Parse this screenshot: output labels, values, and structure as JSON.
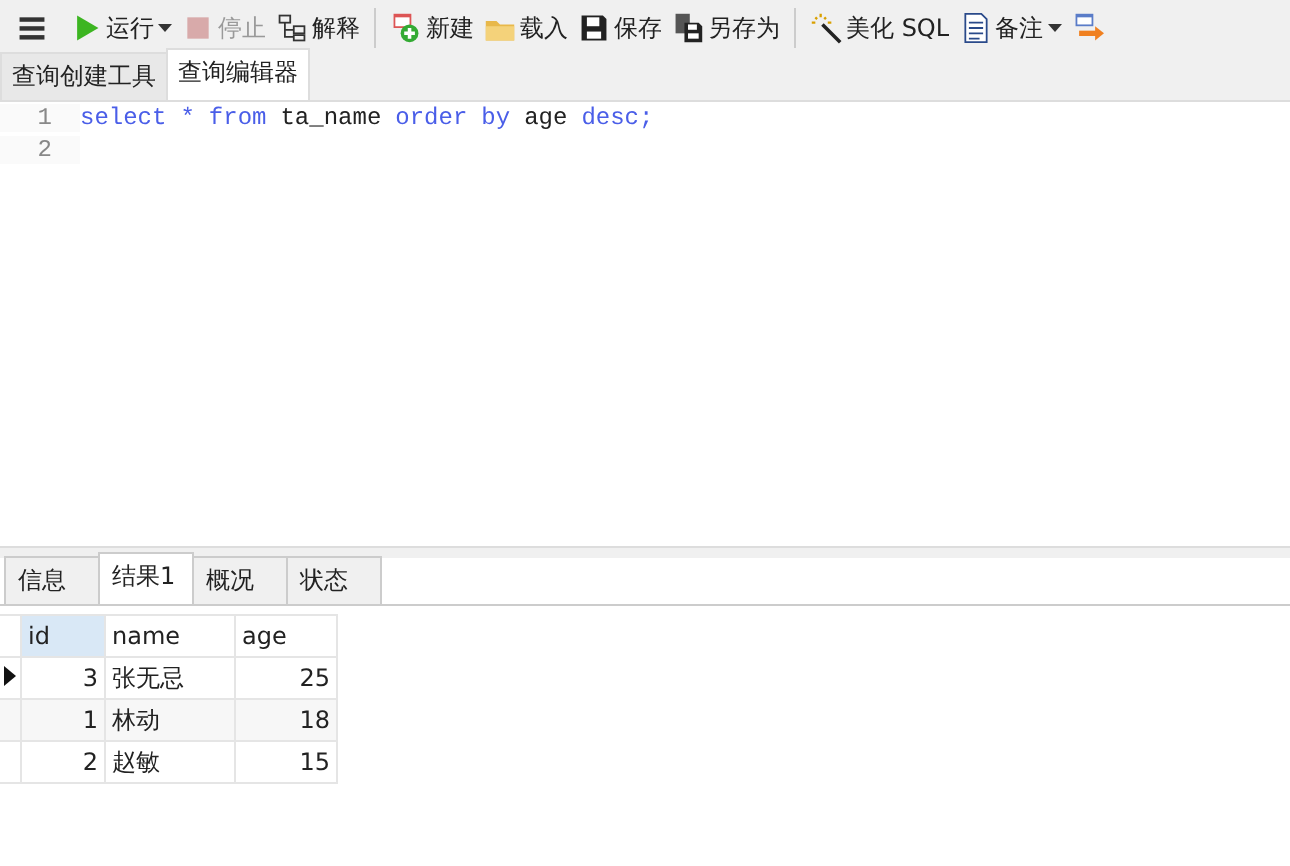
{
  "toolbar": [
    {
      "kind": "menu"
    },
    {
      "kind": "run",
      "label": "运行",
      "dropdown": true,
      "disabled": false
    },
    {
      "kind": "stop",
      "label": "停止",
      "dropdown": false,
      "disabled": true
    },
    {
      "kind": "explain",
      "label": "解释",
      "dropdown": false,
      "disabled": false
    },
    {
      "kind": "separator"
    },
    {
      "kind": "new",
      "label": "新建",
      "dropdown": false,
      "disabled": false
    },
    {
      "kind": "load",
      "label": "载入",
      "dropdown": false,
      "disabled": false
    },
    {
      "kind": "save",
      "label": "保存",
      "dropdown": false,
      "disabled": false
    },
    {
      "kind": "saveas",
      "label": "另存为",
      "dropdown": false,
      "disabled": false
    },
    {
      "kind": "separator"
    },
    {
      "kind": "beautify",
      "label": "美化 SQL",
      "dropdown": false,
      "disabled": false
    },
    {
      "kind": "note",
      "label": "备注",
      "dropdown": true,
      "disabled": false
    },
    {
      "kind": "export"
    }
  ],
  "editor_tabs": [
    {
      "label": "查询创建工具",
      "selected": false
    },
    {
      "label": "查询编辑器",
      "selected": true
    }
  ],
  "editor": {
    "lines": [
      {
        "number": "1",
        "tokens": [
          {
            "kind": "keyword",
            "text": "select"
          },
          {
            "kind": "keyword",
            "text": "*"
          },
          {
            "kind": "keyword",
            "text": "from"
          },
          {
            "kind": "plain",
            "text": "ta_name"
          },
          {
            "kind": "keyword",
            "text": "order"
          },
          {
            "kind": "keyword",
            "text": "by"
          },
          {
            "kind": "plain",
            "text": "age"
          },
          {
            "kind": "keyword",
            "text": "desc"
          }
        ],
        "end": ";"
      },
      {
        "number": "2"
      }
    ]
  },
  "result_tabs": [
    {
      "label": "信息",
      "selected": false
    },
    {
      "label": "结果1",
      "selected": true
    },
    {
      "label": "概况",
      "selected": false
    },
    {
      "label": "状态",
      "selected": false
    }
  ],
  "table": {
    "columns": [
      {
        "label": "id",
        "selected": true,
        "kind": "number"
      },
      {
        "label": "name",
        "selected": false,
        "kind": "text"
      },
      {
        "label": "age",
        "selected": false,
        "kind": "number"
      }
    ],
    "rows": [
      {
        "selected": true,
        "cells": [
          "3",
          "张无忌",
          "25"
        ]
      },
      {
        "selected": false,
        "cells": [
          "1",
          "林动",
          "18"
        ]
      },
      {
        "selected": false,
        "cells": [
          "2",
          "赵敏",
          "15"
        ]
      }
    ]
  }
}
